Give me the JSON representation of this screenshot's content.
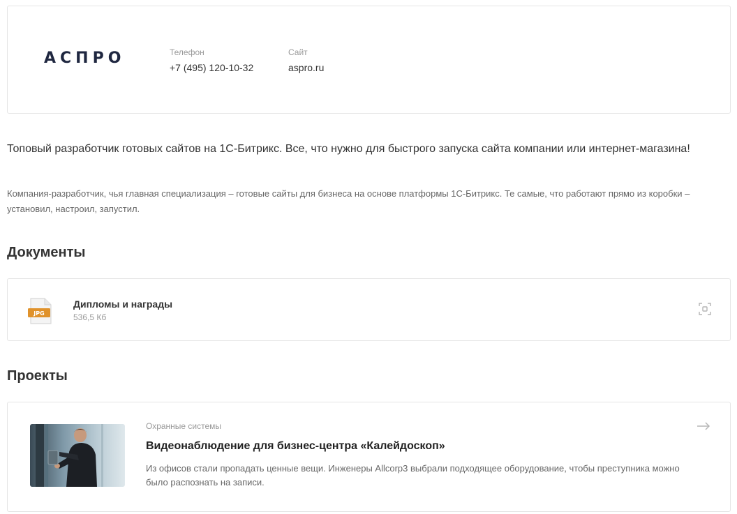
{
  "company": {
    "logo_text": "АСПРО",
    "phone_label": "Телефон",
    "phone_value": "+7 (495) 120-10-32",
    "site_label": "Сайт",
    "site_value": "aspro.ru"
  },
  "about": {
    "lead": "Топовый разработчик готовых сайтов на 1С-Битрикс. Все, что нужно для быстрого запуска сайта компании или интернет-магазина!",
    "description": "Компания-разработчик, чья главная специализация – готовые сайты для бизнеса на основе платформы 1С-Битрикс. Те самые, что работают прямо из коробки – установил, настроил, запустил."
  },
  "documents": {
    "title": "Документы",
    "items": [
      {
        "file_type": "JPG",
        "icon": "jpg-file-icon",
        "name": "Дипломы и награды",
        "size": "536,5 Кб",
        "action_icon": "zoom-icon"
      }
    ]
  },
  "projects": {
    "title": "Проекты",
    "items": [
      {
        "category": "Охранные системы",
        "title": "Видеонаблюдение для бизнес-центра «Калейдоскоп»",
        "description": "Из офисов стали пропадать ценные вещи. Инженеры Allcorp3 выбрали подходящее оборудование, чтобы преступника можно было распознать на записи.",
        "action_icon": "arrow-right-icon"
      }
    ]
  },
  "colors": {
    "logo": "#1f2740",
    "file_icon_accent": "#e0922b",
    "border": "#e5e5e5",
    "muted_text": "#999999"
  }
}
